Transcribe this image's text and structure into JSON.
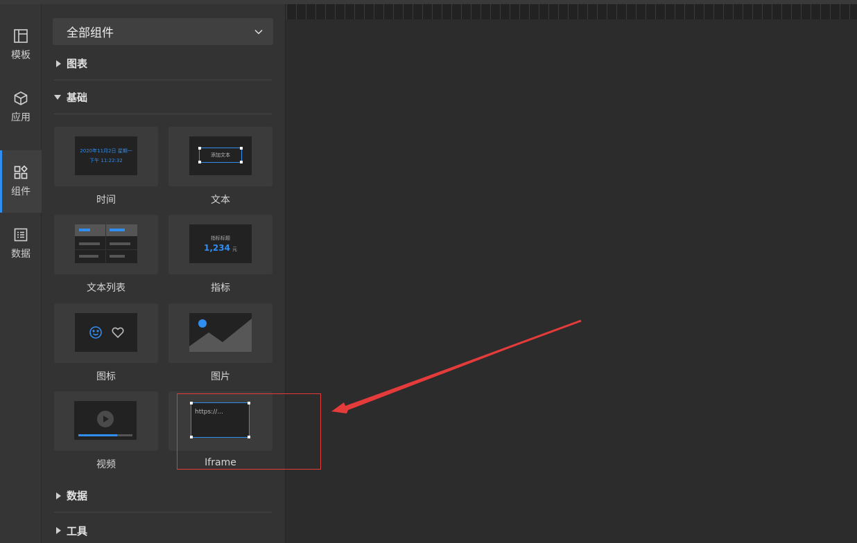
{
  "rail": {
    "items": [
      {
        "label": "模板",
        "icon": "template-icon"
      },
      {
        "label": "应用",
        "icon": "cube-icon"
      },
      {
        "label": "组件",
        "icon": "components-icon"
      },
      {
        "label": "数据",
        "icon": "data-list-icon"
      }
    ],
    "active_index": 2
  },
  "panel": {
    "select_value": "全部组件",
    "groups": {
      "chart": "图表",
      "basic": "基础",
      "data": "数据",
      "tools": "工具"
    },
    "cards": {
      "time": {
        "label": "时间",
        "preview_line1": "2020年11月2日 星期一",
        "preview_line2": "下午 11:22:32"
      },
      "text": {
        "label": "文本",
        "preview": "添加文本"
      },
      "text_list": {
        "label": "文本列表"
      },
      "metric": {
        "label": "指标",
        "preview_title": "指标标题",
        "preview_value": "1,234",
        "preview_unit": "元"
      },
      "icon": {
        "label": "图标"
      },
      "image": {
        "label": "图片"
      },
      "video": {
        "label": "视频"
      },
      "iframe": {
        "label": "Iframe",
        "preview": "https://..."
      }
    }
  },
  "colors": {
    "accent": "#2f8ef0",
    "annotation": "#e53b3b"
  }
}
